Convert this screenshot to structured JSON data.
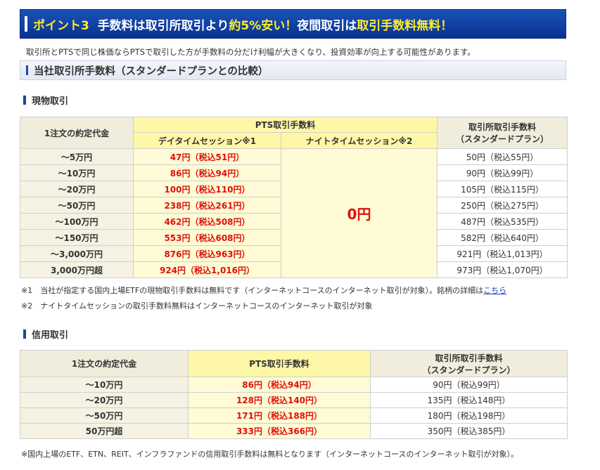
{
  "banner": {
    "part1": "ポイント3",
    "part2": "手数料は取引所取引より",
    "part3": "約5%安い！",
    "part4": "夜間取引は",
    "part5": "取引手数料無料！"
  },
  "intro": "取引所とPTSで同じ株価ならPTSで取引した方が手数料の分だけ利幅が大きくなり、投資効率が向上する可能性があります。",
  "section_title": "当社取引所手数料（スタンダードプランとの比較）",
  "cash": {
    "heading": "現物取引",
    "col_amount": "1注文の約定代金",
    "col_pts": "PTS取引手数料",
    "col_day": "デイタイムセッション※1",
    "col_night": "ナイトタイムセッション※2",
    "col_std_1": "取引所取引手数料",
    "col_std_2": "（スタンダードプラン）",
    "night_value": "0円",
    "rows": [
      {
        "amount": "～5万円",
        "day": "47円（税込51円）",
        "std": "50円（税込55円）"
      },
      {
        "amount": "～10万円",
        "day": "86円（税込94円）",
        "std": "90円（税込99円）"
      },
      {
        "amount": "～20万円",
        "day": "100円（税込110円）",
        "std": "105円（税込115円）"
      },
      {
        "amount": "～50万円",
        "day": "238円（税込261円）",
        "std": "250円（税込275円）"
      },
      {
        "amount": "～100万円",
        "day": "462円（税込508円）",
        "std": "487円（税込535円）"
      },
      {
        "amount": "～150万円",
        "day": "553円（税込608円）",
        "std": "582円（税込640円）"
      },
      {
        "amount": "～3,000万円",
        "day": "876円（税込963円）",
        "std": "921円（税込1,013円）"
      },
      {
        "amount": "3,000万円超",
        "day": "924円（税込1,016円）",
        "std": "973円（税込1,070円）"
      }
    ],
    "note1": "※1　当社が指定する国内上場ETFの現物取引手数料は無料です（インターネットコースのインターネット取引が対象）。銘柄の詳細は",
    "note1_link": "こちら",
    "note2": "※2　ナイトタイムセッションの取引手数料無料はインターネットコースのインターネット取引が対象"
  },
  "margin": {
    "heading": "信用取引",
    "col_amount": "1注文の約定代金",
    "col_pts": "PTS取引手数料",
    "col_std_1": "取引所取引手数料",
    "col_std_2": "（スタンダードプラン）",
    "rows": [
      {
        "amount": "～10万円",
        "pts": "86円（税込94円）",
        "std": "90円（税込99円）"
      },
      {
        "amount": "～20万円",
        "pts": "128円（税込140円）",
        "std": "135円（税込148円）"
      },
      {
        "amount": "～50万円",
        "pts": "171円（税込188円）",
        "std": "180円（税込198円）"
      },
      {
        "amount": "50万円超",
        "pts": "333円（税込366円）",
        "std": "350円（税込385円）"
      }
    ],
    "note": "※国内上場のETF、ETN、REIT、インフラファンドの信用取引手数料は無料となります（インターネットコースのインターネット取引が対象）。"
  }
}
